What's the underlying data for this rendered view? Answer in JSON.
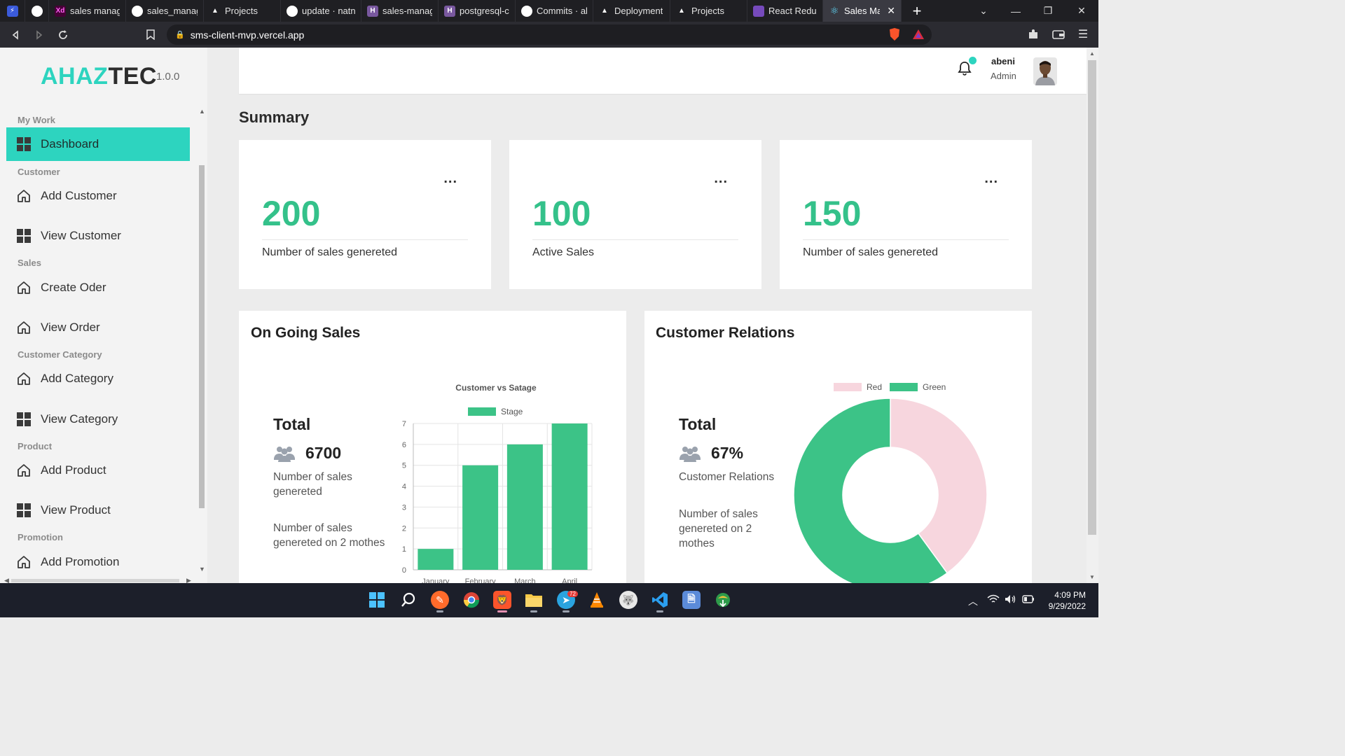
{
  "browser": {
    "tabs": [
      {
        "label": "sales manage",
        "icon": "adobe-xd-icon",
        "color": "#470137"
      },
      {
        "label": "sales_manage",
        "icon": "github-icon",
        "color": "#ffffff"
      },
      {
        "label": "Projects",
        "icon": "vercel-icon",
        "color": "#ffffff"
      },
      {
        "label": "update · natn",
        "icon": "github-icon",
        "color": "#ffffff"
      },
      {
        "label": "sales-manage",
        "icon": "heroku-icon",
        "color": "#79589f"
      },
      {
        "label": "postgresql-cu",
        "icon": "heroku-icon",
        "color": "#79589f"
      },
      {
        "label": "Commits · ab",
        "icon": "github-icon",
        "color": "#ffffff"
      },
      {
        "label": "Deployment",
        "icon": "vercel-icon",
        "color": "#ffffff"
      },
      {
        "label": "Projects",
        "icon": "vercel-icon",
        "color": "#ffffff"
      },
      {
        "label": "React Redux",
        "icon": "redux-icon",
        "color": "#764abc"
      },
      {
        "label": "Sales Mar",
        "icon": "react-icon",
        "color": "#61dafb",
        "active": true
      }
    ],
    "url": "sms-client-mvp.vercel.app"
  },
  "app": {
    "logo_part1": "AHAZ",
    "logo_part2": "TEC",
    "version": "1.0.0",
    "accent": "#2dd4bf",
    "number_color": "#34c18a"
  },
  "sidebar": {
    "sections": [
      {
        "label": "My Work",
        "items": [
          {
            "label": "Dashboard",
            "icon": "grid-icon",
            "active": true
          }
        ]
      },
      {
        "label": "Customer",
        "items": [
          {
            "label": "Add Customer",
            "icon": "home-icon"
          },
          {
            "label": "View Customer",
            "icon": "grid-icon"
          }
        ]
      },
      {
        "label": "Sales",
        "items": [
          {
            "label": "Create Oder",
            "icon": "home-icon"
          },
          {
            "label": "View Order",
            "icon": "home-icon"
          }
        ]
      },
      {
        "label": "Customer Category",
        "items": [
          {
            "label": "Add Category",
            "icon": "home-icon"
          },
          {
            "label": "View Category",
            "icon": "grid-icon"
          }
        ]
      },
      {
        "label": "Product",
        "items": [
          {
            "label": "Add Product",
            "icon": "home-icon"
          },
          {
            "label": "View Product",
            "icon": "grid-icon"
          }
        ]
      },
      {
        "label": "Promotion",
        "items": [
          {
            "label": "Add Promotion",
            "icon": "home-icon"
          }
        ]
      }
    ]
  },
  "header": {
    "user_name": "abeni",
    "user_role": "Admin"
  },
  "summary": {
    "title": "Summary",
    "cards": [
      {
        "value": "200",
        "label": "Number of sales genereted",
        "menu": "..."
      },
      {
        "value": "100",
        "label": "Active Sales",
        "menu": "..."
      },
      {
        "value": "150",
        "label": "Number of sales genereted",
        "menu": "..."
      }
    ]
  },
  "ongoing": {
    "title": "On Going Sales",
    "total_label": "Total",
    "total_value": "6700",
    "desc1": "Number of sales genereted",
    "desc2": "Number of sales genereted on 2 mothes"
  },
  "relations": {
    "title": "Customer Relations",
    "total_label": "Total",
    "total_value": "67%",
    "desc1": "Customer Relations",
    "desc2": "Number of sales genereted on 2 mothes"
  },
  "chart_data": [
    {
      "type": "bar",
      "title": "Customer vs Satage",
      "categories": [
        "January",
        "February",
        "March",
        "April"
      ],
      "series": [
        {
          "name": "Stage",
          "values": [
            1,
            5,
            6,
            7
          ],
          "color": "#3cc387"
        }
      ],
      "ylim": [
        0,
        7
      ],
      "yticks": [
        "0",
        "1",
        "2",
        "3",
        "4",
        "5",
        "6",
        "7"
      ],
      "grid": true,
      "legend": "top"
    },
    {
      "type": "pie",
      "title": "",
      "labels": [
        "Red",
        "Green"
      ],
      "values": [
        40,
        60
      ],
      "colors": [
        "#f7d6de",
        "#3cc387"
      ],
      "donut": true,
      "legend": "top"
    }
  ],
  "taskbar": {
    "time": "4:09 PM",
    "date": "9/29/2022",
    "telegram_badge": "72"
  }
}
